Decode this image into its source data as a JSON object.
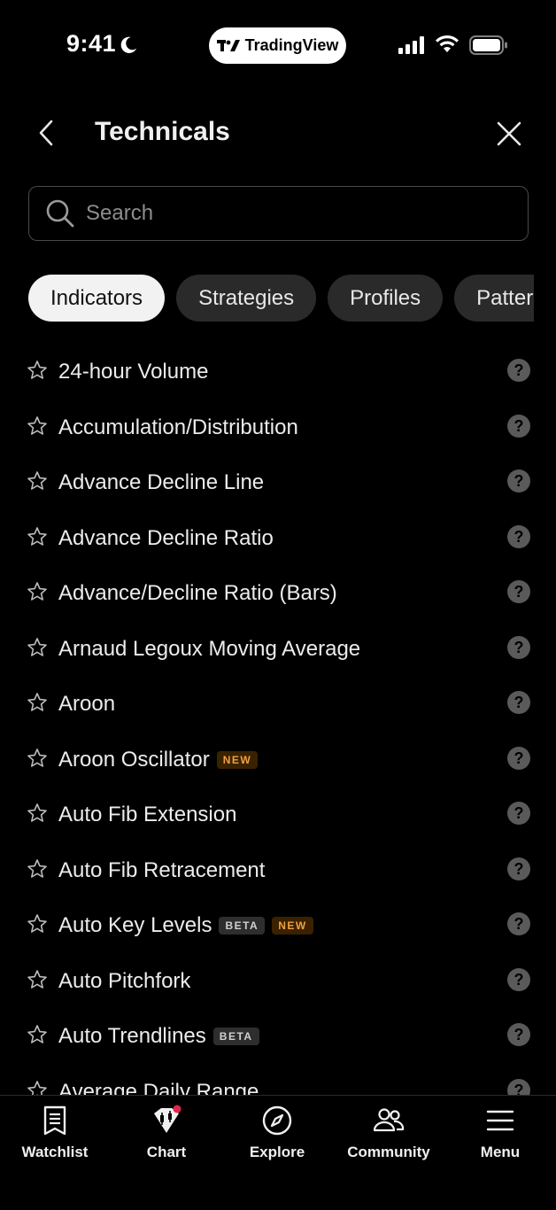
{
  "status_bar": {
    "time": "9:41",
    "app_pill": "TradingView"
  },
  "header": {
    "title": "Technicals"
  },
  "search": {
    "placeholder": "Search"
  },
  "chips": [
    {
      "label": "Indicators",
      "active": true
    },
    {
      "label": "Strategies",
      "active": false
    },
    {
      "label": "Profiles",
      "active": false
    },
    {
      "label": "Patterns",
      "active": false
    }
  ],
  "list": [
    {
      "label": "24-hour Volume",
      "badges": []
    },
    {
      "label": "Accumulation/Distribution",
      "badges": []
    },
    {
      "label": "Advance Decline Line",
      "badges": []
    },
    {
      "label": "Advance Decline Ratio",
      "badges": []
    },
    {
      "label": "Advance/Decline Ratio (Bars)",
      "badges": []
    },
    {
      "label": "Arnaud Legoux Moving Average",
      "badges": []
    },
    {
      "label": "Aroon",
      "badges": []
    },
    {
      "label": "Aroon Oscillator",
      "badges": [
        "NEW"
      ]
    },
    {
      "label": "Auto Fib Extension",
      "badges": []
    },
    {
      "label": "Auto Fib Retracement",
      "badges": []
    },
    {
      "label": "Auto Key Levels",
      "badges": [
        "BETA",
        "NEW"
      ]
    },
    {
      "label": "Auto Pitchfork",
      "badges": []
    },
    {
      "label": "Auto Trendlines",
      "badges": [
        "BETA"
      ]
    },
    {
      "label": "Average Daily Range",
      "badges": []
    }
  ],
  "help_glyph": "?",
  "tabbar": {
    "watchlist": "Watchlist",
    "chart": "Chart",
    "explore": "Explore",
    "community": "Community",
    "menu": "Menu"
  },
  "colors": {
    "background": "#000000",
    "chip_active": "#f2f2f2",
    "chip_inactive": "#2a2a2a",
    "new_badge_text": "#f0a040",
    "notification_dot": "#e0284a"
  }
}
